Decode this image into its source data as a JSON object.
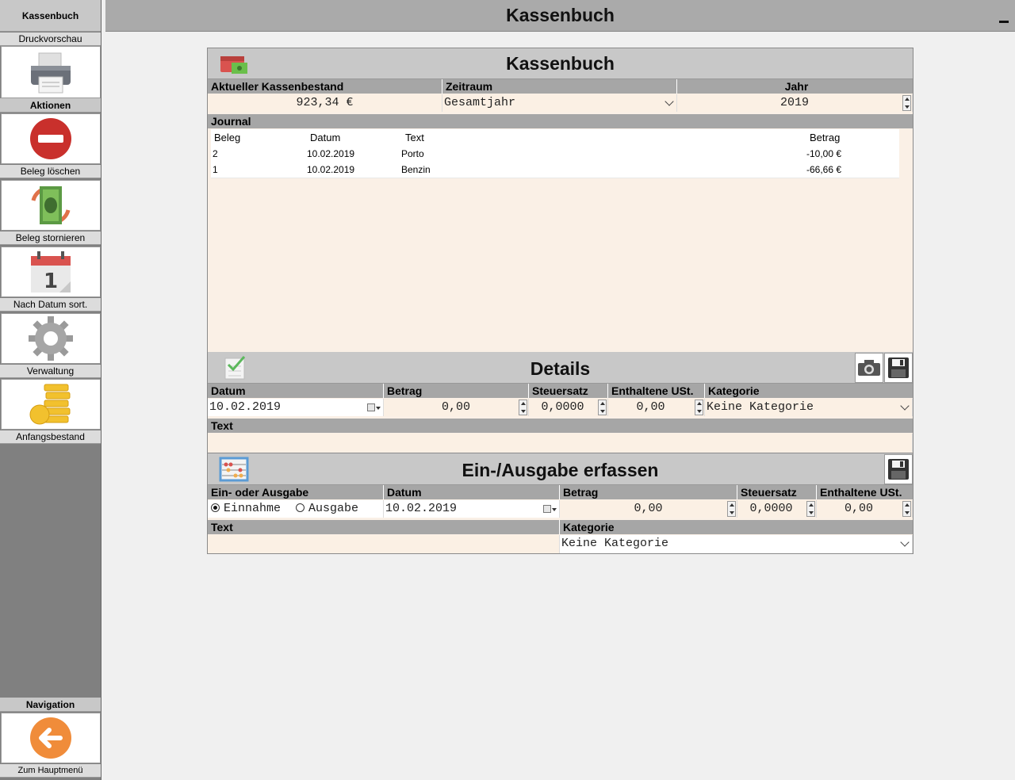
{
  "window": {
    "title": "Kassenbuch"
  },
  "sidebar": {
    "header": "Kassenbuch",
    "print_label": "Druckvorschau",
    "actions_header": "Aktionen",
    "delete_label": "Beleg löschen",
    "cancel_label": "Beleg stornieren",
    "sort_label": "Nach Datum sort.",
    "admin_label": "Verwaltung",
    "opening_label": "Anfangsbestand",
    "nav_header": "Navigation",
    "home_label": "Zum Hauptmenü",
    "calendar_day": "1"
  },
  "main": {
    "title": "Kassenbuch",
    "balance_label": "Aktueller Kassenbestand",
    "balance_value": "923,34 €",
    "period_label": "Zeitraum",
    "period_value": "Gesamtjahr",
    "year_label": "Jahr",
    "year_value": "2019",
    "journal_label": "Journal",
    "journal": {
      "columns": [
        "Beleg",
        "Datum",
        "Text",
        "Betrag"
      ],
      "rows": [
        {
          "beleg": "2",
          "datum": "10.02.2019",
          "text": "Porto",
          "betrag": "-10,00 €"
        },
        {
          "beleg": "1",
          "datum": "10.02.2019",
          "text": "Benzin",
          "betrag": "-66,66 €"
        }
      ]
    }
  },
  "details": {
    "title": "Details",
    "date_label": "Datum",
    "date_value": "10.02.2019",
    "amount_label": "Betrag",
    "amount_value": "0,00",
    "tax_label": "Steuersatz",
    "tax_value": "0,0000",
    "vat_label": "Enthaltene USt.",
    "vat_value": "0,00",
    "category_label": "Kategorie",
    "category_value": "Keine Kategorie",
    "text_label": "Text",
    "text_value": ""
  },
  "entry": {
    "title": "Ein-/Ausgabe erfassen",
    "type_label": "Ein- oder Ausgabe",
    "income_label": "Einnahme",
    "expense_label": "Ausgabe",
    "selected": "income",
    "date_label": "Datum",
    "date_value": "10.02.2019",
    "amount_label": "Betrag",
    "amount_value": "0,00",
    "tax_label": "Steuersatz",
    "tax_value": "0,0000",
    "vat_label": "Enthaltene USt.",
    "vat_value": "0,00",
    "text_label": "Text",
    "text_value": "",
    "category_label": "Kategorie",
    "category_value": "Keine Kategorie"
  }
}
